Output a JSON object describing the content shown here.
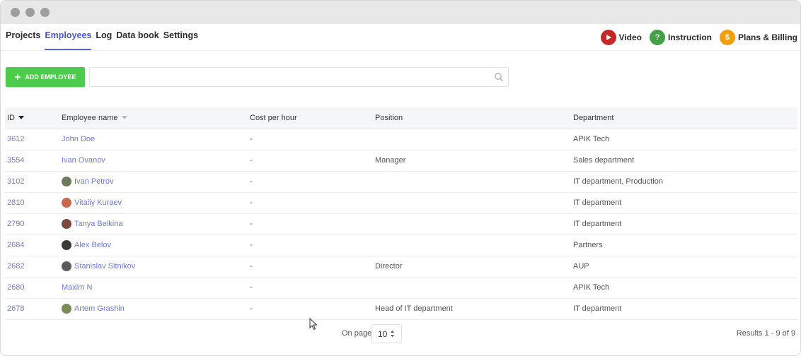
{
  "nav": {
    "links": [
      "Projects",
      "Employees",
      "Log",
      "Data book",
      "Settings"
    ],
    "active": "Employees",
    "help": [
      {
        "label": "Video",
        "icon": "play-icon",
        "color": "#c62828"
      },
      {
        "label": "Instruction",
        "icon": "question-icon",
        "color": "#43a047"
      },
      {
        "label": "Plans & Billing",
        "icon": "dollar-icon",
        "color": "#f59e0b"
      }
    ]
  },
  "toolbar": {
    "add_label": "ADD EMPLOYEE",
    "search_placeholder": ""
  },
  "table": {
    "columns": [
      "ID",
      "Employee name",
      "Cost per hour",
      "Position",
      "Department"
    ],
    "rows": [
      {
        "id": "3612",
        "name": "John Doe",
        "cost": "-",
        "position": "",
        "department": "APIK Tech",
        "avatar": ""
      },
      {
        "id": "3554",
        "name": "Ivan Ovanov",
        "cost": "-",
        "position": "Manager",
        "department": "Sales department",
        "avatar": ""
      },
      {
        "id": "3102",
        "name": "Ivan Petrov",
        "cost": "-",
        "position": "",
        "department": "IT department, Production",
        "avatar": "#6d7b5a"
      },
      {
        "id": "2810",
        "name": "Vitaliy Kuraev",
        "cost": "-",
        "position": "",
        "department": "IT department",
        "avatar": "#c8694f"
      },
      {
        "id": "2790",
        "name": "Tanya Belkina",
        "cost": "-",
        "position": "",
        "department": "IT department",
        "avatar": "#7a4a3d"
      },
      {
        "id": "2684",
        "name": "Alex Belov",
        "cost": "-",
        "position": "",
        "department": "Partners",
        "avatar": "#3a3a3a"
      },
      {
        "id": "2682",
        "name": "Stanislav Sitnikov",
        "cost": "-",
        "position": "Director",
        "department": "AUP",
        "avatar": "#5b5b5b"
      },
      {
        "id": "2680",
        "name": "Maxim N",
        "cost": "-",
        "position": "",
        "department": "APIK Tech",
        "avatar": ""
      },
      {
        "id": "2678",
        "name": "Artem Grashin",
        "cost": "-",
        "position": "Head of IT department",
        "department": "IT department",
        "avatar": "#7c8a55"
      }
    ]
  },
  "pager": {
    "label": "On page",
    "per_page": "10",
    "results": "Results 1 - 9 of 9"
  }
}
